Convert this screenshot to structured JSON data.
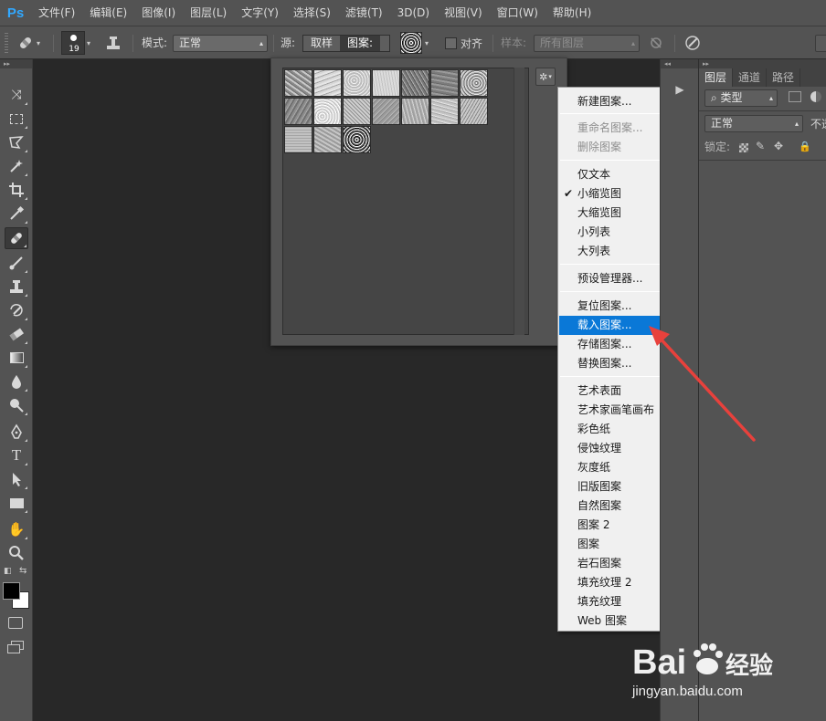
{
  "app": {
    "logo": "Ps",
    "accent": "#31a8ff"
  },
  "menubar": {
    "items": [
      "文件(F)",
      "编辑(E)",
      "图像(I)",
      "图层(L)",
      "文字(Y)",
      "选择(S)",
      "滤镜(T)",
      "3D(D)",
      "视图(V)",
      "窗口(W)",
      "帮助(H)"
    ]
  },
  "options": {
    "brush_size": "19",
    "mode_label": "模式:",
    "mode_value": "正常",
    "source_label": "源:",
    "source_sampled": "取样",
    "source_pattern": "图案:",
    "align_label": "对齐",
    "align_checked": false,
    "sample_label": "样本:",
    "sample_value": "所有图层"
  },
  "pattern_picker": {
    "gear_icon": "gear-icon",
    "swatch_count": 17
  },
  "flyout_menu": {
    "highlight_color": "#0a78d7",
    "items": [
      {
        "label": "新建图案...",
        "state": "normal"
      },
      {
        "label": "重命名图案...",
        "state": "disabled"
      },
      {
        "label": "删除图案",
        "state": "disabled"
      },
      {
        "label": "仅文本",
        "state": "normal"
      },
      {
        "label": "小缩览图",
        "state": "checked"
      },
      {
        "label": "大缩览图",
        "state": "normal"
      },
      {
        "label": "小列表",
        "state": "normal"
      },
      {
        "label": "大列表",
        "state": "normal"
      },
      {
        "label": "预设管理器...",
        "state": "normal"
      },
      {
        "label": "复位图案...",
        "state": "normal"
      },
      {
        "label": "载入图案...",
        "state": "highlighted"
      },
      {
        "label": "存储图案...",
        "state": "normal"
      },
      {
        "label": "替换图案...",
        "state": "normal"
      },
      {
        "label": "艺术表面",
        "state": "normal"
      },
      {
        "label": "艺术家画笔画布",
        "state": "normal"
      },
      {
        "label": "彩色纸",
        "state": "normal"
      },
      {
        "label": "侵蚀纹理",
        "state": "normal"
      },
      {
        "label": "灰度纸",
        "state": "normal"
      },
      {
        "label": "旧版图案",
        "state": "normal"
      },
      {
        "label": "自然图案",
        "state": "normal"
      },
      {
        "label": "图案 2",
        "state": "normal"
      },
      {
        "label": "图案",
        "state": "normal"
      },
      {
        "label": "岩石图案",
        "state": "normal"
      },
      {
        "label": "填充纹理 2",
        "state": "normal"
      },
      {
        "label": "填充纹理",
        "state": "normal"
      },
      {
        "label": "Web 图案",
        "state": "normal"
      }
    ]
  },
  "layers_panel": {
    "tabs": [
      "图层",
      "通道",
      "路径"
    ],
    "active_tab": "图层",
    "kind_filter": "类型",
    "blend_mode": "正常",
    "opacity_label": "不透",
    "lock_label": "锁定:"
  },
  "annotation": {
    "arrow_color": "#e8413c"
  },
  "watermark": {
    "brand": "Bai",
    "brand_suffix": "经验",
    "url": "jingyan.baidu.com"
  }
}
